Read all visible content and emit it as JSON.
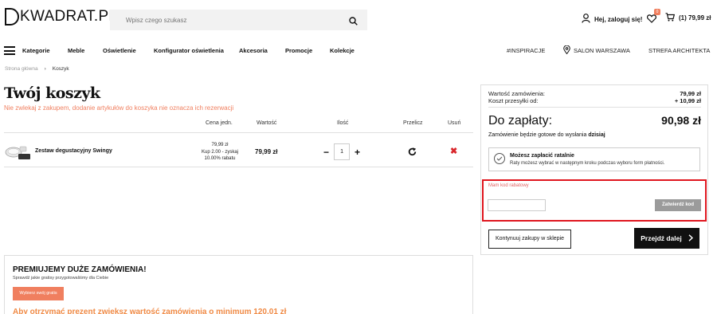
{
  "header": {
    "logo": "KWADRAT.PL",
    "search_placeholder": "Wpisz czego szukasz",
    "login_label": "Hej, zaloguj się!",
    "wishlist_count": "0",
    "cart_label": "(1) 79,99 zł"
  },
  "nav": {
    "items": [
      "Kategorie",
      "Meble",
      "Oświetlenie",
      "Konfigurator oświetlenia",
      "Akcesoria",
      "Promocje",
      "Kolekcje"
    ],
    "right": [
      "#INSPIRACJE",
      "SALON WARSZAWA",
      "STREFA ARCHITEKTA"
    ]
  },
  "breadcrumb": {
    "home": "Strona główna",
    "current": "Koszyk"
  },
  "cart": {
    "title": "Twój koszyk",
    "notice": "Nie zwlekaj z zakupem, dodanie artykułów do koszyka nie oznacza ich rezerwacji",
    "columns": {
      "unit_price": "Cena jedn.",
      "value": "Wartość",
      "qty": "Ilość",
      "recalc": "Przelicz",
      "remove": "Usuń"
    },
    "items": [
      {
        "name": "Zestaw degustacyjny Swingy",
        "unit_price": "79,99 zł",
        "discount_line1": "Kup 2.00 - zyskaj",
        "discount_line2": "10.00% rabatu",
        "value": "79,99 zł",
        "qty": "1"
      }
    ]
  },
  "promo": {
    "title": "PREMIUJEMY DUŻE ZAMÓWIENIA!",
    "subtitle": "Sprawdź jakie gratisy przygotowaliśmy dla Ciebie",
    "button": "Wybierz swój gratis",
    "goal": "Aby otrzymać prezent zwiększ wartość zamówienia o minimum 120,01 zł"
  },
  "summary": {
    "order_value_label": "Wartość zamówienia:",
    "order_value": "79,99 zł",
    "shipping_label": "Koszt przesyłki od:",
    "shipping_value": "+ 10,99 zł",
    "to_pay_label": "Do zapłaty:",
    "to_pay_value": "90,98 zł",
    "ready_prefix": "Zamówienie będzie gotowe do wysłania",
    "ready_when": "dzisiaj",
    "installments_title": "Możesz zapłacić ratalnie",
    "installments_sub": "Raty możesz wybrać w następnym kroku podczas wyboru form płatności.",
    "coupon_label": "Mam kod rabatowy",
    "coupon_button": "Zatwierdź kod",
    "continue_button": "Kontynuuj zakupy w sklepie",
    "next_button": "Przejdź dalej"
  },
  "colors": {
    "accent": "#f07f5f",
    "danger": "#e0161e",
    "dark": "#111111"
  }
}
